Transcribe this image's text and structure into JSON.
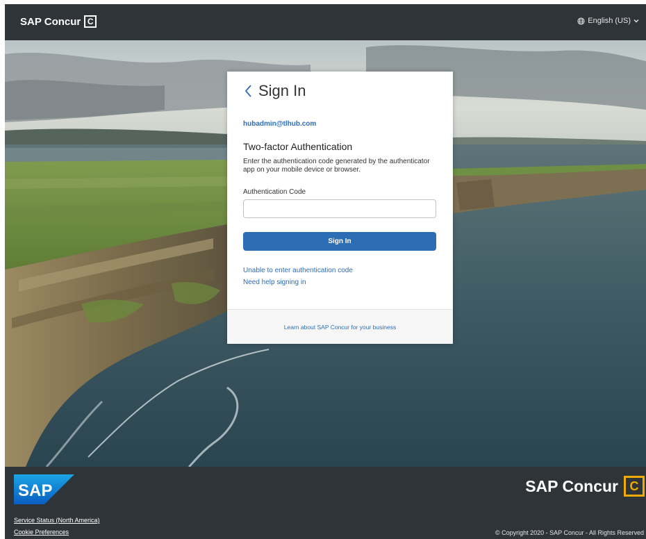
{
  "header": {
    "brand": "SAP Concur",
    "brand_mark": "C",
    "language": "English (US)",
    "language_icon": "globe-icon",
    "dropdown_icon": "chevron-down-icon"
  },
  "card": {
    "title": "Sign In",
    "back_icon": "chevron-left-icon",
    "email": "hubadmin@tlhub.com",
    "heading": "Two-factor Authentication",
    "description": "Enter the authentication code generated by the authenticator app on your mobile device or browser.",
    "field_label": "Authentication Code",
    "field_value": "",
    "button_label": "Sign In",
    "links": [
      "Unable to enter authentication code",
      "Need help signing in"
    ],
    "footer_link": "Learn about SAP Concur for your business"
  },
  "footer": {
    "sap_logo": "SAP",
    "brand": "SAP Concur",
    "brand_mark": "C",
    "links": [
      "Service Status (North America)",
      "Cookie Preferences"
    ],
    "copyright": "© Copyright 2020 - SAP Concur - All Rights Reserved"
  },
  "colors": {
    "header_bg": "#2f3439",
    "accent": "#2d6db3",
    "link": "#2a6cb5",
    "brand_gold": "#f0ab00",
    "sap_blue": "#1a7bd0"
  }
}
